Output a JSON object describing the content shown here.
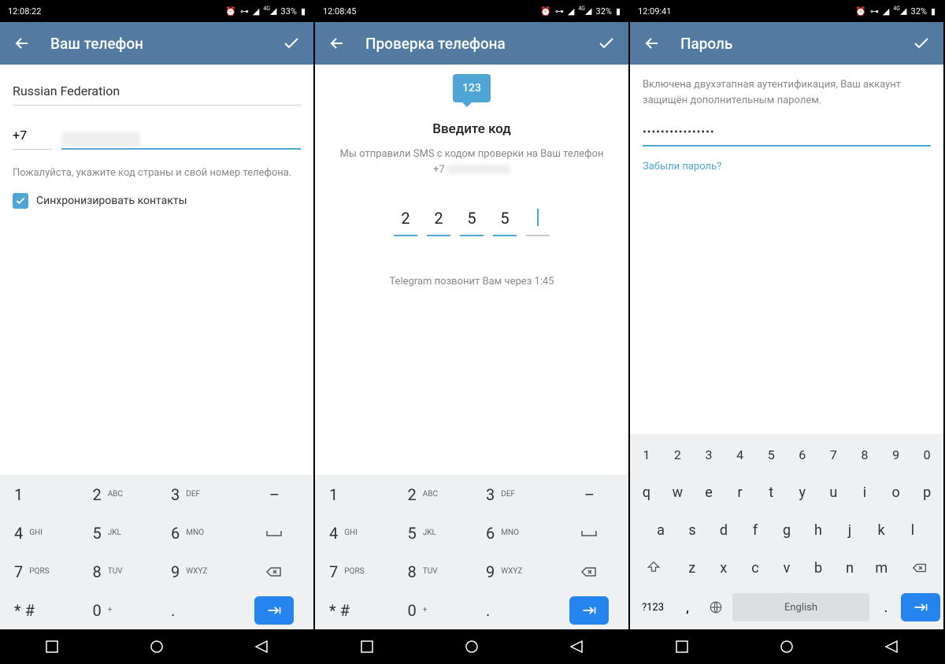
{
  "screens": [
    {
      "status": {
        "time": "12:08:22",
        "battery": "33%"
      },
      "header": {
        "title": "Ваш телефон"
      },
      "country": "Russian Federation",
      "country_code": "+7",
      "hint": "Пожалуйста, укажите код страны и свой номер телефона.",
      "checkbox_label": "Синхронизировать контакты"
    },
    {
      "status": {
        "time": "12:08:45",
        "battery": "32%"
      },
      "header": {
        "title": "Проверка телефона"
      },
      "bubble": "123",
      "verify_title": "Введите код",
      "verify_desc": "Мы отправили SMS с кодом проверки на Ваш телефон",
      "verify_phone": "+7",
      "code": [
        "2",
        "2",
        "5",
        "5",
        ""
      ],
      "countdown": "Telegram позвонит Вам через 1:45"
    },
    {
      "status": {
        "time": "12:09:41",
        "battery": "32%"
      },
      "header": {
        "title": "Пароль"
      },
      "pwd_desc": "Включена двухэтапная аутентификация, Ваш аккаунт защищён дополнительным паролем.",
      "pwd_value": "••••••••••••••••",
      "forgot": "Забыли пароль?"
    }
  ],
  "numpad": [
    {
      "d": "1",
      "s": ""
    },
    {
      "d": "2",
      "s": "ABC"
    },
    {
      "d": "3",
      "s": "DEF"
    },
    {
      "d": "–",
      "s": "",
      "action": true
    },
    {
      "d": "4",
      "s": "GHI"
    },
    {
      "d": "5",
      "s": "JKL"
    },
    {
      "d": "6",
      "s": "MNO"
    },
    {
      "d": "␣",
      "s": "",
      "action": true,
      "space": true
    },
    {
      "d": "7",
      "s": "PQRS"
    },
    {
      "d": "8",
      "s": "TUV"
    },
    {
      "d": "9",
      "s": "WXYZ"
    },
    {
      "d": "",
      "s": "",
      "action": true,
      "backspace": true
    },
    {
      "d": "* #",
      "s": ""
    },
    {
      "d": "0",
      "s": "+"
    },
    {
      "d": ".",
      "s": ""
    },
    {
      "d": "",
      "s": "",
      "action": true,
      "enter": true
    }
  ],
  "qwerty": {
    "row_num": [
      "1",
      "2",
      "3",
      "4",
      "5",
      "6",
      "7",
      "8",
      "9",
      "0"
    ],
    "row1": [
      "q",
      "w",
      "e",
      "r",
      "t",
      "y",
      "u",
      "i",
      "o",
      "p"
    ],
    "row2": [
      "a",
      "s",
      "d",
      "f",
      "g",
      "h",
      "j",
      "k",
      "l"
    ],
    "row3": [
      "z",
      "x",
      "c",
      "v",
      "b",
      "n",
      "m"
    ],
    "sym": "?123",
    "space": "English"
  }
}
